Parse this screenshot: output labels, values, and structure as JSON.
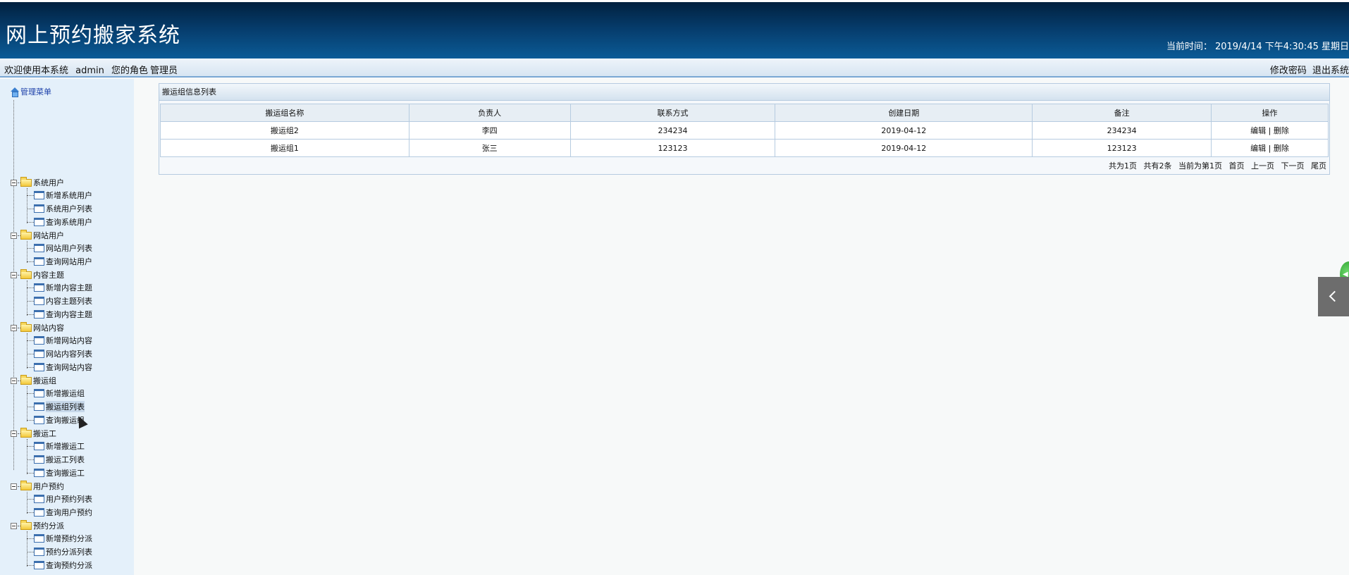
{
  "header": {
    "app_title": "网上预约搬家系统",
    "time_label": "当前时间：",
    "time_value": "2019/4/14 下午4:30:45 星期日"
  },
  "welcome": {
    "greeting": "欢迎使用本系统",
    "username": "admin",
    "role_label": "您的角色",
    "role": "管理员",
    "change_password": "修改密码",
    "logout": "退出系统"
  },
  "sidebar": {
    "root": "管理菜单",
    "groups": [
      {
        "label": "系统用户",
        "items": [
          "新增系统用户",
          "系统用户列表",
          "查询系统用户"
        ]
      },
      {
        "label": "网站用户",
        "items": [
          "网站用户列表",
          "查询网站用户"
        ]
      },
      {
        "label": "内容主题",
        "items": [
          "新增内容主题",
          "内容主题列表",
          "查询内容主题"
        ]
      },
      {
        "label": "网站内容",
        "items": [
          "新增网站内容",
          "网站内容列表",
          "查询网站内容"
        ]
      },
      {
        "label": "搬运组",
        "items": [
          "新增搬运组",
          "搬运组列表",
          "查询搬运组"
        ]
      },
      {
        "label": "搬运工",
        "items": [
          "新增搬运工",
          "搬运工列表",
          "查询搬运工"
        ]
      },
      {
        "label": "用户预约",
        "items": [
          "用户预约列表",
          "查询用户预约"
        ]
      },
      {
        "label": "预约分派",
        "items": [
          "新增预约分派",
          "预约分派列表",
          "查询预约分派"
        ]
      }
    ],
    "selected_item": "搬运组列表"
  },
  "panel": {
    "title": "搬运组信息列表",
    "columns": [
      "搬运组名称",
      "负责人",
      "联系方式",
      "创建日期",
      "备注",
      "操作"
    ],
    "rows": [
      {
        "name": "搬运组2",
        "leader": "李四",
        "contact": "234234",
        "created": "2019-04-12",
        "remark": "234234",
        "edit": "编辑",
        "sep": "|",
        "delete": "删除"
      },
      {
        "name": "搬运组1",
        "leader": "张三",
        "contact": "123123",
        "created": "2019-04-12",
        "remark": "123123",
        "edit": "编辑",
        "sep": "|",
        "delete": "删除"
      }
    ],
    "pager": {
      "total_pages": "共为1页",
      "total_records": "共有2条",
      "current_page": "当前为第1页",
      "first": "首页",
      "prev": "上一页",
      "next": "下一页",
      "last": "尾页"
    }
  },
  "icons": {
    "collapse": "chevron-left-icon",
    "float_button": "green-circle-icon"
  }
}
